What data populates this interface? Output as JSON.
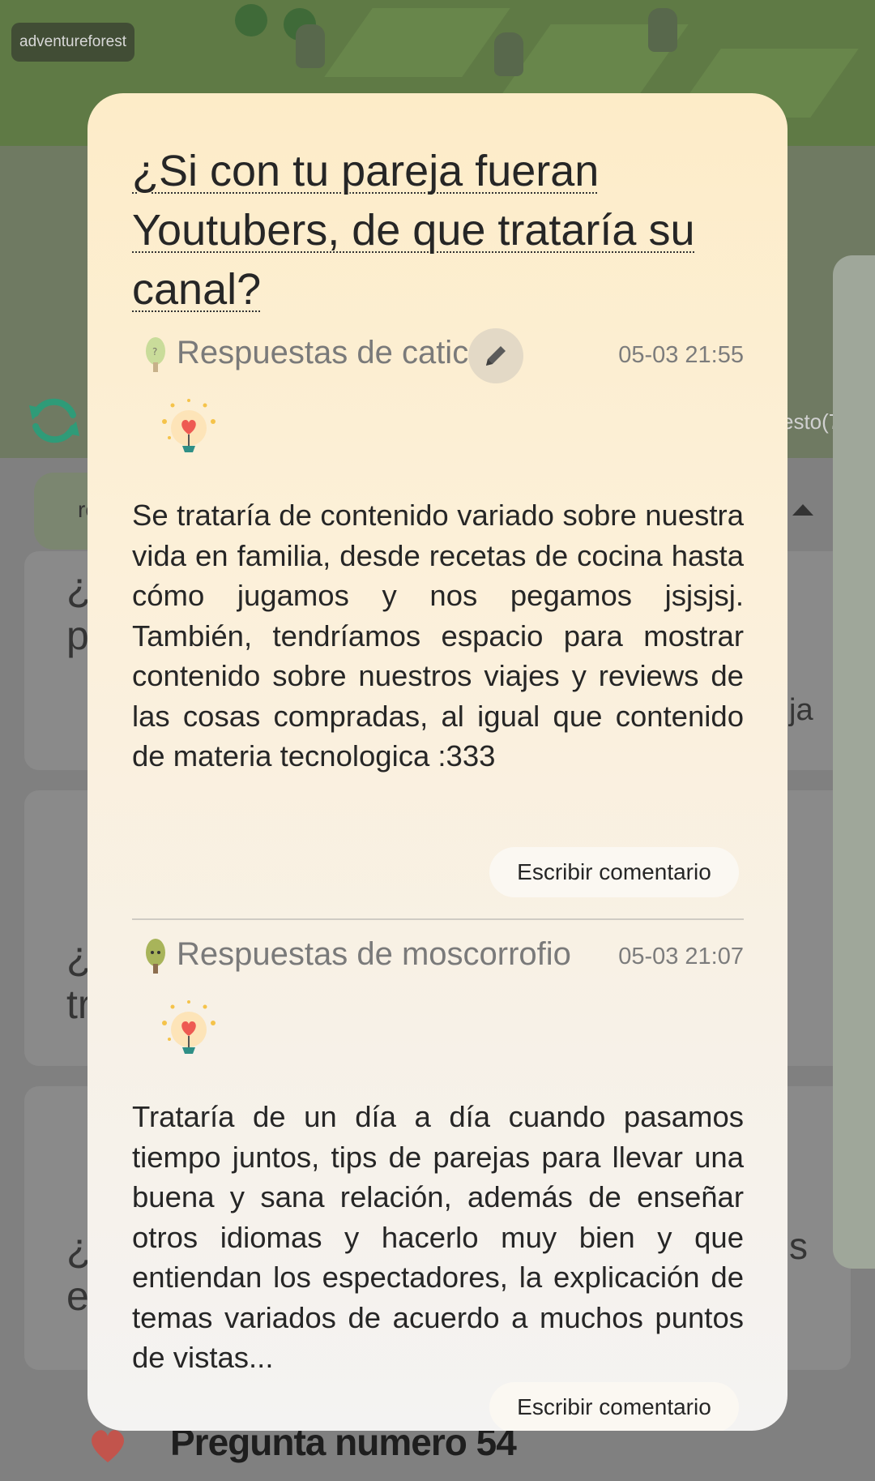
{
  "background": {
    "world_name": "adventureforest",
    "partial_label_right": "esto(7",
    "partial_pill_text": "re",
    "partial_side_text": "ja",
    "partial_side_text_2": "s",
    "bottom_question_title": "Pregunta numero 54",
    "bg_partial_lines": [
      "¿l",
      "p",
      "¿S",
      "tr",
      "¿(",
      "e"
    ]
  },
  "modal": {
    "question_title": "¿Si con tu pareja fueran Youtubers, de que trataría su canal?",
    "answers": [
      {
        "author": "Respuestas de catica",
        "time": "05-03 21:55",
        "body": "Se trataría de contenido variado sobre nuestra vida en familia, desde recetas de cocina hasta cómo jugamos y nos pegamos jsjsjsj. También, tendríamos espacio para mostrar contenido sobre nuestros viajes y reviews de las cosas compradas, al igual que contenido de materia tecnologica :333",
        "comment_label": "Escribir comentario",
        "has_edit": true
      },
      {
        "author": "Respuestas de moscorrofio",
        "time": "05-03 21:07",
        "body": "Trataría de un día a día cuando pasamos tiempo juntos, tips de parejas para llevar una buena y sana relación, además de enseñar otros idiomas y hacerlo muy bien y que entiendan los espectadores, la explicación de temas variados de acuerdo a muchos puntos de vistas...",
        "comment_label": "Escribir comentario",
        "has_edit": false
      }
    ]
  },
  "colors": {
    "modal_top": "#fdecc8",
    "modal_bottom": "#f4f3f2",
    "text": "#262626",
    "muted": "#7a7a7a",
    "refresh_accent": "#2f9b78",
    "heart": "#e0574f"
  },
  "icons": [
    "refresh-icon",
    "tree-icon",
    "edit-pencil-icon",
    "lightbulb-heart-icon",
    "heart-icon"
  ]
}
